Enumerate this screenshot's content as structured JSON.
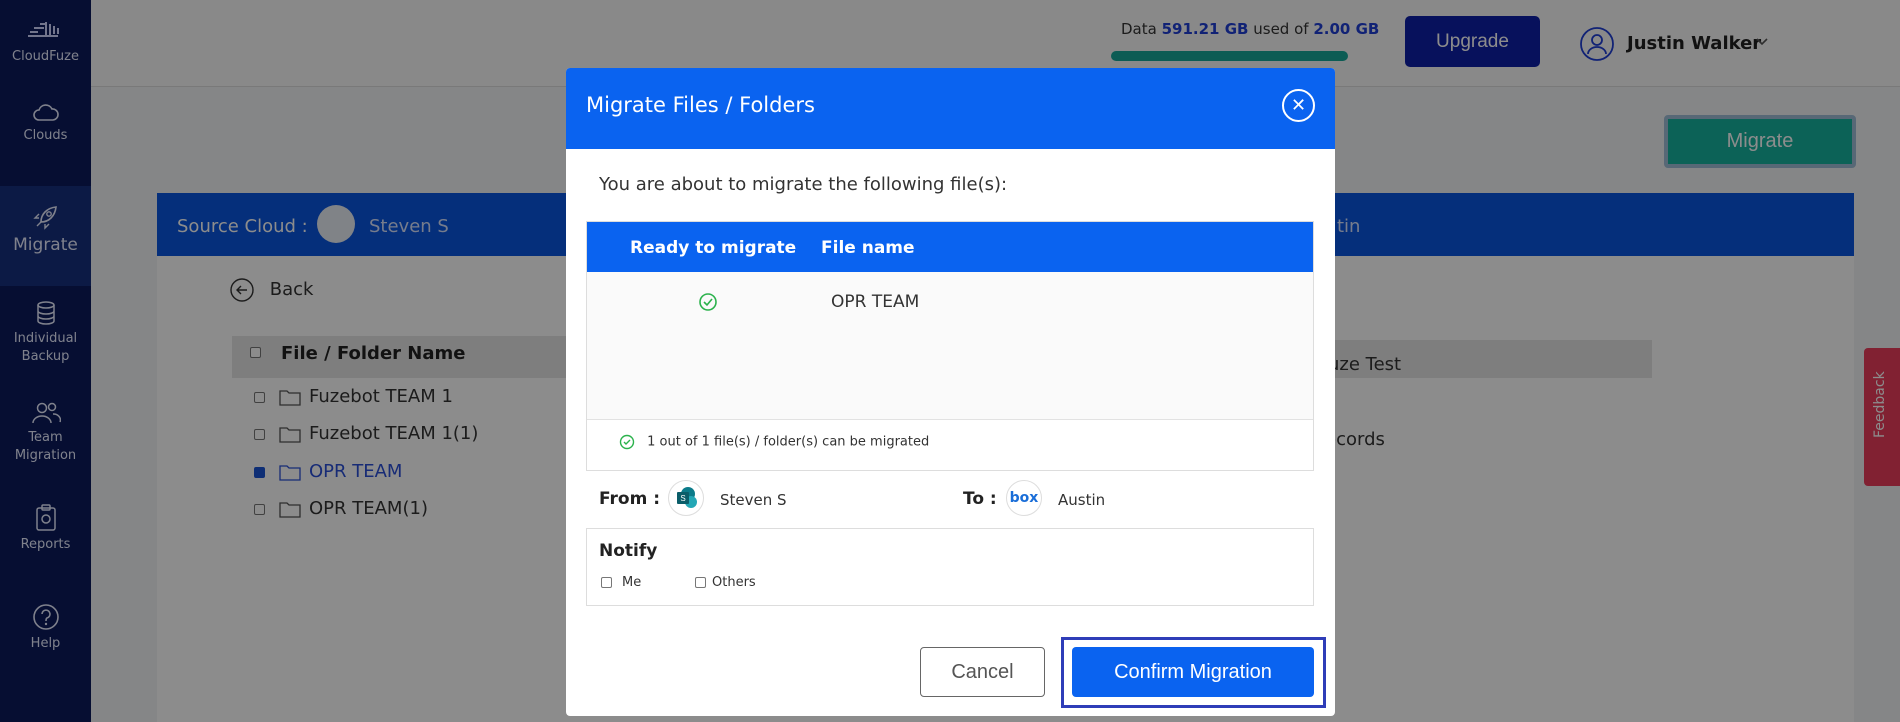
{
  "app": {
    "brand": "CloudFuze"
  },
  "sidebar": {
    "items": [
      {
        "label": "Clouds",
        "icon": "cloud-icon"
      },
      {
        "label": "Migrate",
        "icon": "rocket-icon",
        "active": true
      },
      {
        "label_line1": "Individual",
        "label_line2": "Backup",
        "icon": "database-icon"
      },
      {
        "label_line1": "Team",
        "label_line2": "Migration",
        "icon": "users-icon"
      },
      {
        "label": "Reports",
        "icon": "clipboard-icon"
      },
      {
        "label": "Help",
        "icon": "help-icon"
      }
    ]
  },
  "topbar": {
    "data_prefix": "Data",
    "data_used": "591.21 GB",
    "data_mid": "used of",
    "data_total": "2.00 GB",
    "upgrade_label": "Upgrade",
    "user_name": "Justin Walker"
  },
  "page": {
    "migrate_label": "Migrate",
    "source_label": "Source Cloud :",
    "source_name": "Steven S",
    "target_name_partial": "tin",
    "back_label": "Back",
    "file_header": "File / Folder Name",
    "files": [
      {
        "name": "Fuzebot TEAM 1",
        "checked": false
      },
      {
        "name": "Fuzebot TEAM 1(1)",
        "checked": false
      },
      {
        "name": "OPR TEAM",
        "checked": true
      },
      {
        "name": "OPR TEAM(1)",
        "checked": false
      }
    ],
    "right_text_1": "uze Test",
    "right_text_2": "ecords",
    "feedback_label": "Feedback"
  },
  "modal": {
    "title": "Migrate Files / Folders",
    "intro": "You are about to migrate the following file(s):",
    "col_ready": "Ready to migrate",
    "col_file": "File name",
    "rows": [
      {
        "name": "OPR TEAM",
        "ready": true
      }
    ],
    "summary": "1 out of 1 file(s) / folder(s) can be migrated",
    "from_label": "From :",
    "from_name": "Steven S",
    "to_label": "To :",
    "to_icon_text": "box",
    "to_name": "Austin",
    "notify_title": "Notify",
    "notify_me": "Me",
    "notify_others": "Others",
    "cancel_label": "Cancel",
    "confirm_label": "Confirm Migration"
  },
  "colors": {
    "sidebar": "#0b1b5c",
    "primary": "#0a63f0",
    "teal": "#17b39f",
    "upgrade": "#0d1fa8",
    "feedback": "#ec3c5c",
    "success": "#2bb24c"
  }
}
